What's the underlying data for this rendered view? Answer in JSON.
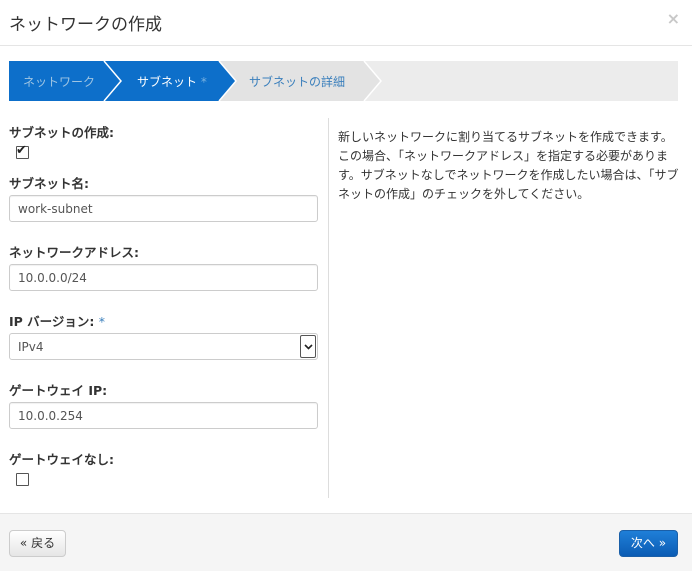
{
  "header": {
    "title": "ネットワークの作成",
    "close_glyph": "×"
  },
  "wizard": {
    "steps": [
      {
        "label": "ネットワーク",
        "required_mark": "",
        "state": "completed"
      },
      {
        "label": "サブネット",
        "required_mark": "*",
        "state": "active"
      },
      {
        "label": "サブネットの詳細",
        "required_mark": "",
        "state": "upcoming"
      }
    ],
    "colors": {
      "completed": "#0d6fca",
      "active": "#0d6fca",
      "upcoming": "#ececec"
    }
  },
  "form": {
    "create_subnet": {
      "label": "サブネットの作成:",
      "checked": true,
      "check_glyph": "✔"
    },
    "subnet_name": {
      "label": "サブネット名:",
      "value": "work-subnet"
    },
    "network_address": {
      "label": "ネットワークアドレス:",
      "value": "10.0.0.0/24"
    },
    "ip_version": {
      "label": "IP バージョン:",
      "required_mark": "*",
      "value": "IPv4"
    },
    "gateway_ip": {
      "label": "ゲートウェイ IP:",
      "value": "10.0.0.254"
    },
    "no_gateway": {
      "label": "ゲートウェイなし:",
      "checked": false
    }
  },
  "help": {
    "text": "新しいネットワークに割り当てるサブネットを作成できます。この場合、「ネットワークアドレス」を指定する必要があります。サブネットなしでネットワークを作成したい場合は、「サブネットの作成」のチェックを外してください。"
  },
  "footer": {
    "back_label": "« 戻る",
    "next_label": "次へ »",
    "primary_color": "#0d6fca"
  }
}
